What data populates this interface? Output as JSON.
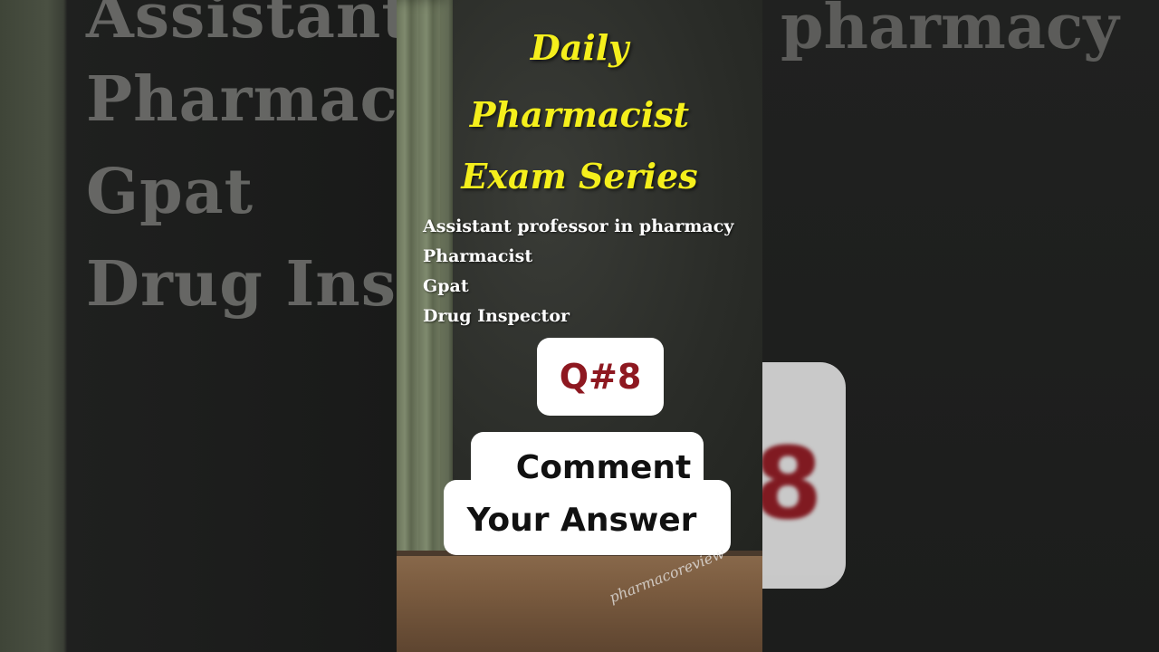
{
  "title_lines": [
    "Daily",
    "Pharmacist",
    "Exam Series"
  ],
  "exams": [
    "Assistant professor in pharmacy",
    "Pharmacist",
    "Gpat",
    "Drug Inspector"
  ],
  "question_label": "Q#8",
  "cta_lines": [
    "Comment",
    "Your Answer"
  ],
  "watermark": "pharmacoreview",
  "blurred_background": {
    "left_lines": [
      "Assistant",
      "Pharmacis",
      "Gpat",
      "Drug Inspec"
    ],
    "right_line": "pharmacy",
    "right_card_char": "8"
  },
  "colors": {
    "title": "#f5ef1c",
    "question": "#8e1820",
    "card": "#ffffff"
  }
}
